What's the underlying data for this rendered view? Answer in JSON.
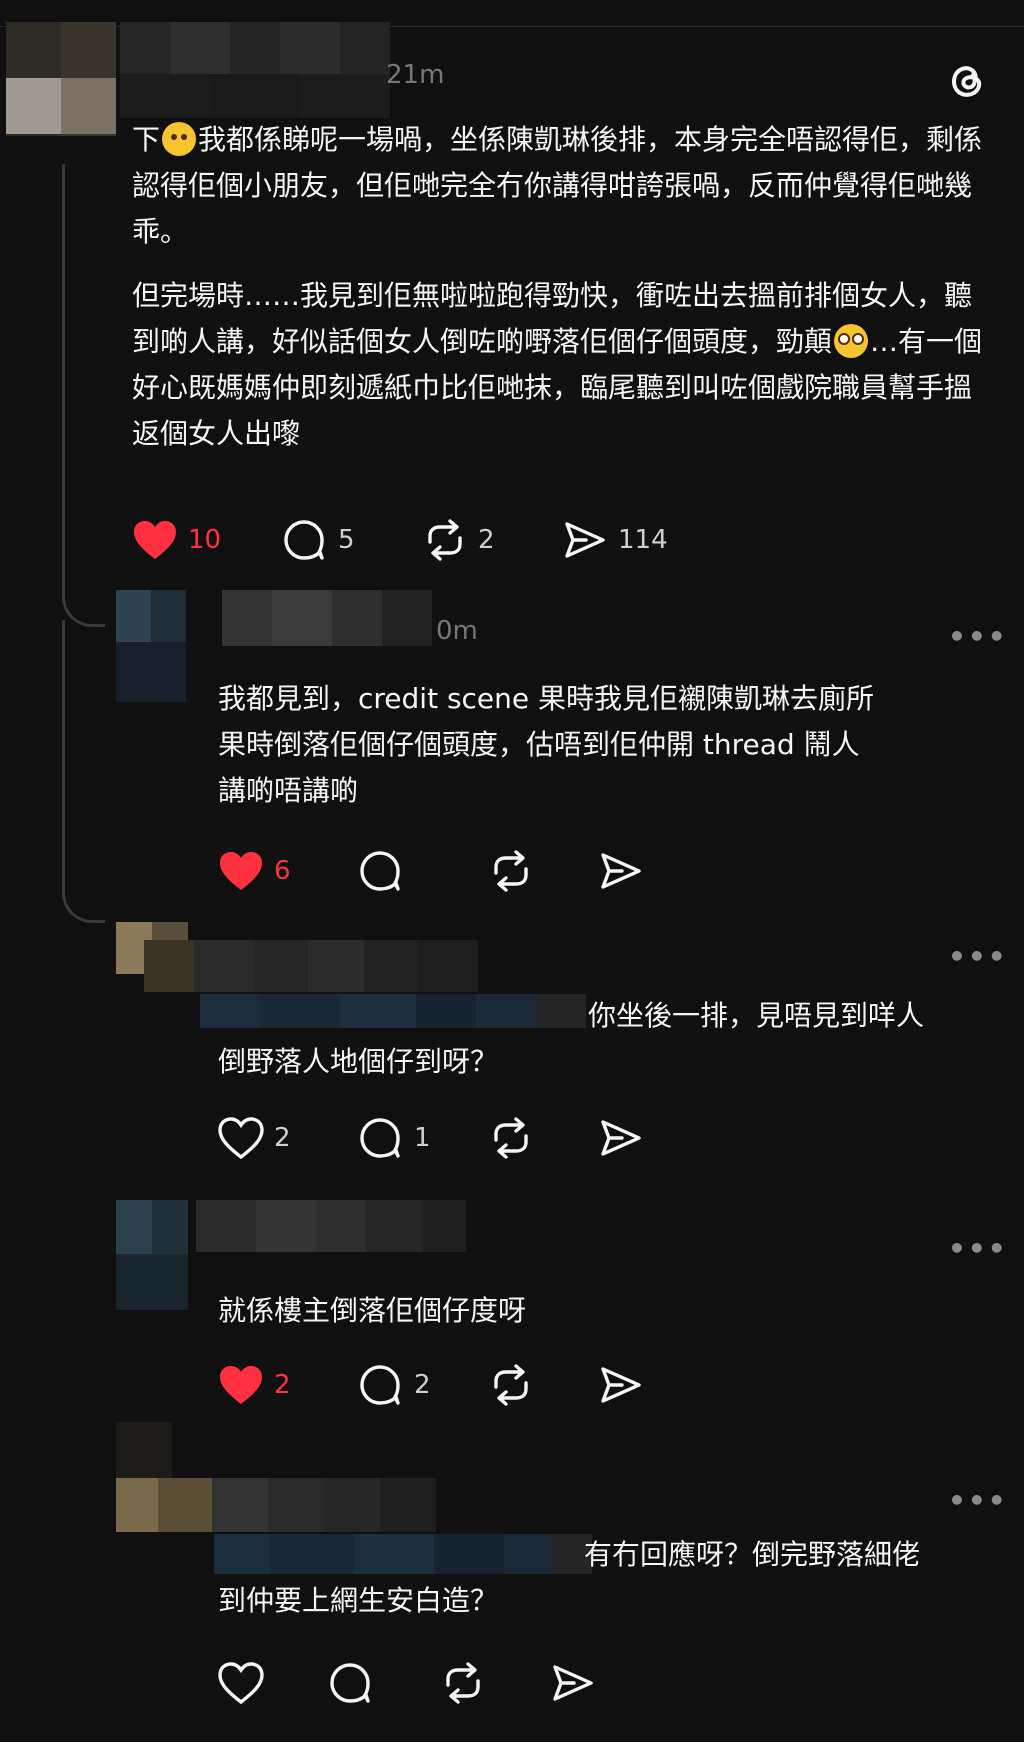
{
  "post": {
    "time": "21m",
    "paragraphs": [
      {
        "before": "下",
        "emoji": "face-with-raised-eyebrow",
        "after": "我都係睇呢一場喎，坐係陳凱琳後排，本身完全唔認得佢，剩係認得佢個小朋友，但佢哋完全冇你講得咁誇張喎，反而仲覺得佢哋幾乖。"
      },
      {
        "before": "但完場時……我見到佢無啦啦跑得勁快，衝咗出去搵前排個女人，聽到啲人講，好似話個女人倒咗啲嘢落佢個仔個頭度，勁顛",
        "emoji": "flushed-face",
        "after": "…有一個好心既媽媽仲即刻遞紙巾比佢哋抹，臨尾聽到叫咗個戲院職員幫手搵返個女人出嚟"
      }
    ],
    "likes": "10",
    "replies": "5",
    "reposts": "2",
    "shares": "114"
  },
  "replies": [
    {
      "time": "0m",
      "lines": [
        "我都見到，credit scene 果時我見佢襯陳凱琳去廁所",
        "果時倒落佢個仔個頭度，估唔到佢仲開 thread 鬧人",
        "講啲唔講啲"
      ],
      "likes": "6",
      "liked": true,
      "comments": ""
    },
    {
      "lines": [
        "你坐後一排，見唔見到咩人",
        "倒野落人地個仔到呀？"
      ],
      "likes": "2",
      "liked": false,
      "comments": "1"
    },
    {
      "lines": [
        "就係樓主倒落佢個仔度呀"
      ],
      "likes": "2",
      "liked": true,
      "comments": "2"
    },
    {
      "lines": [
        "有冇回應呀？倒完野落細佬",
        "到仲要上網生安白造？"
      ],
      "likes": "",
      "liked": false,
      "comments": ""
    }
  ],
  "more_label": "•••",
  "icons": {
    "logo": "threads-logo-icon",
    "like": "heart-icon",
    "comment": "comment-bubble-icon",
    "repost": "repost-icon",
    "share": "send-icon",
    "more": "more-dots-icon"
  },
  "colors": {
    "background": "#101010",
    "text": "#f3f5f7",
    "muted": "#777777",
    "like_red": "#ff3040"
  }
}
